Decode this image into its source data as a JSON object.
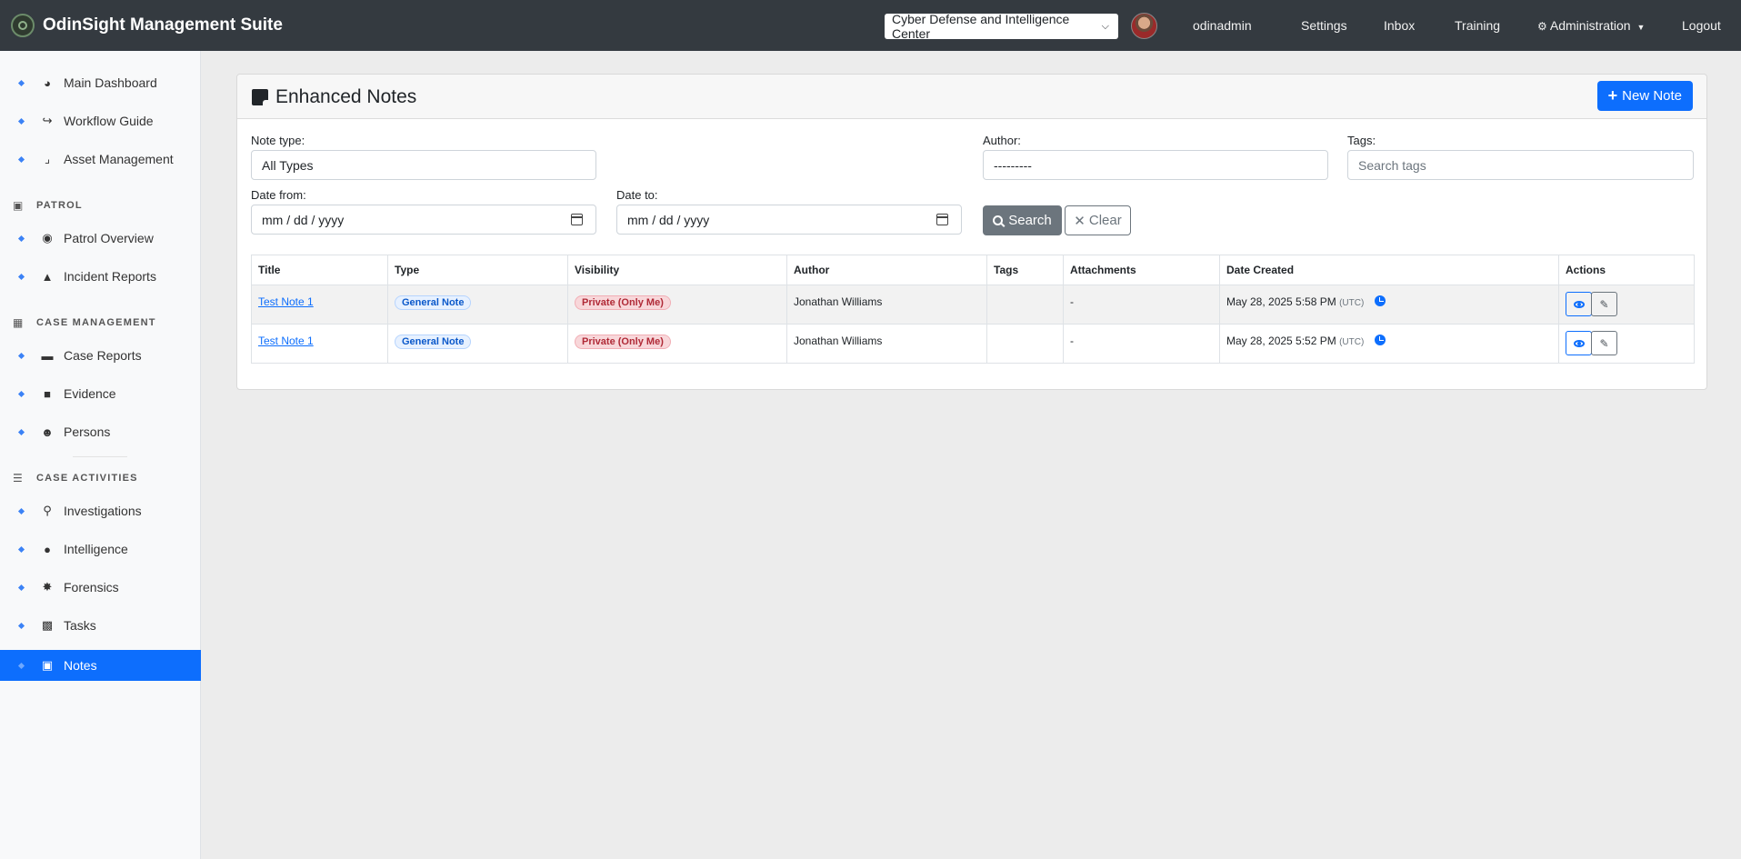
{
  "app": {
    "name": "OdinSight Management Suite",
    "org_selector": "Cyber Defense and Intelligence Center",
    "username": "odinadmin"
  },
  "topnav": [
    "Settings",
    "Inbox",
    "Training",
    "Administration",
    "Logout"
  ],
  "sidebar": {
    "top_items": [
      "Main Dashboard",
      "Workflow Guide",
      "Asset Management"
    ],
    "sections": [
      {
        "title": "PATROL",
        "items": [
          "Patrol Overview",
          "Incident Reports"
        ]
      },
      {
        "title": "CASE MANAGEMENT",
        "items": [
          "Case Reports",
          "Evidence",
          "Persons"
        ]
      },
      {
        "title": "CASE ACTIVITIES",
        "items": [
          "Investigations",
          "Intelligence",
          "Forensics",
          "Tasks",
          "Notes"
        ]
      }
    ],
    "active": "Notes"
  },
  "page": {
    "title": "Enhanced Notes",
    "new_button": "New Note"
  },
  "filters": {
    "note_type_label": "Note type:",
    "note_type_value": "All Types",
    "author_label": "Author:",
    "author_value": "---------",
    "tags_label": "Tags:",
    "tags_placeholder": "Search tags",
    "date_from_label": "Date from:",
    "date_from_value": "mm / dd / yyyy",
    "date_to_label": "Date to:",
    "date_to_value": "mm / dd / yyyy",
    "search_label": "Search",
    "clear_label": "Clear"
  },
  "table": {
    "columns": [
      "Title",
      "Type",
      "Visibility",
      "Author",
      "Tags",
      "Attachments",
      "Date Created",
      "Actions"
    ],
    "rows": [
      {
        "title": "Test Note 1",
        "type": "General Note",
        "visibility": "Private (Only Me)",
        "author": "Jonathan Williams",
        "tags": "",
        "attachments": "-",
        "date": "May 28, 2025 5:58 PM",
        "tz": "(UTC)"
      },
      {
        "title": "Test Note 1",
        "type": "General Note",
        "visibility": "Private (Only Me)",
        "author": "Jonathan Williams",
        "tags": "",
        "attachments": "-",
        "date": "May 28, 2025 5:52 PM",
        "tz": "(UTC)"
      }
    ]
  },
  "colors": {
    "topbar": "#343a40",
    "accent": "#0d6efd",
    "sidebar_bg": "#f8f9fa"
  }
}
